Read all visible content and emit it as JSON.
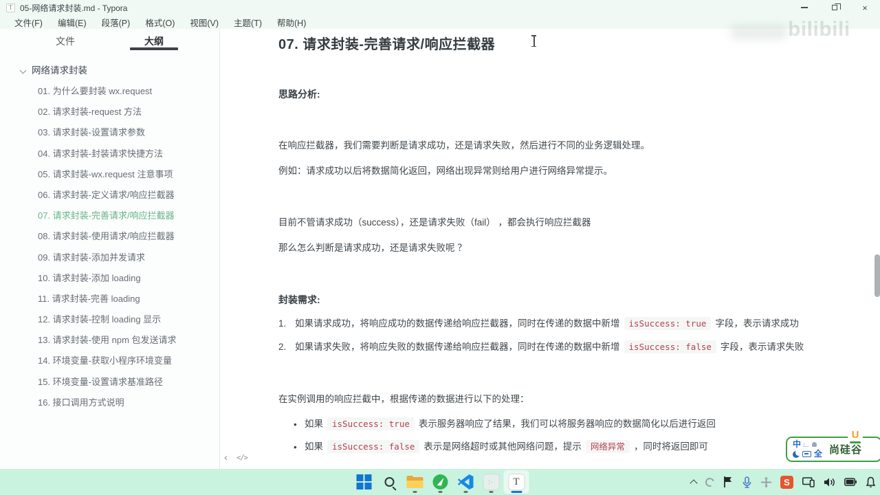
{
  "window": {
    "app_icon": "T",
    "title": "05-网络请求封装.md - Typora",
    "menu": [
      "文件(F)",
      "编辑(E)",
      "段落(P)",
      "格式(O)",
      "视图(V)",
      "主题(T)",
      "帮助(H)"
    ],
    "controls": {
      "close": "×"
    }
  },
  "sidebar": {
    "tabs": {
      "files": "文件",
      "outline": "大纲"
    },
    "root": "网络请求封装",
    "items": [
      "01. 为什么要封装 wx.request",
      "02. 请求封装-request 方法",
      "03. 请求封装-设置请求参数",
      "04. 请求封装-封装请求快捷方法",
      "05. 请求封装-wx.request 注意事项",
      "06. 请求封装-定义请求/响应拦截器",
      "07. 请求封装-完善请求/响应拦截器",
      "08. 请求封装-使用请求/响应拦截器",
      "09. 请求封装-添加并发请求",
      "10. 请求封装-添加 loading",
      "11. 请求封装-完善 loading",
      "12. 请求封装-控制 loading 显示",
      "13. 请求封装-使用 npm 包发送请求",
      "14. 环境变量-获取小程序环境变量",
      "15. 环境变量-设置请求基准路径",
      "16. 接口调用方式说明"
    ],
    "active_item": "07. 请求封装-完善请求/响应拦截器"
  },
  "editor_footer": {
    "collapse": "‹",
    "source_mode": "</>"
  },
  "content": {
    "heading": "07. 请求封装-完善请求/响应拦截器",
    "analysis_label": "思路分析:",
    "p1": "在响应拦截器，我们需要判断是请求成功，还是请求失败，然后进行不同的业务逻辑处理。",
    "p2": "例如：请求成功以后将数据简化返回，网络出现异常则给用户进行网络异常提示。",
    "p3": "目前不管请求成功（success），还是请求失败（fail） ，都会执行响应拦截器",
    "p4": "那么怎么判断是请求成功，还是请求失败呢 ？",
    "require_label": "封装需求:",
    "ol": [
      {
        "num": "1.",
        "pre": "如果请求成功，将响应成功的数据传递给响应拦截器，同时在传递的数据中新增",
        "code": "isSuccess: true",
        "post": "字段，表示请求成功"
      },
      {
        "num": "2.",
        "pre": "如果请求失败，将响应失败的数据传递给响应拦截器，同时在传递的数据中新增",
        "code": "isSuccess: false",
        "post": "字段，表示请求失败"
      }
    ],
    "p5": "在实例调用的响应拦截中，根据传递的数据进行以下的处理：",
    "ul": [
      {
        "pre": "如果",
        "code": "isSuccess: true",
        "post": "表示服务器响应了结果，我们可以将服务器响应的数据简化以后进行返回"
      },
      {
        "pre": "如果",
        "code": "isSuccess: false",
        "mid": "表示是网络超时或其他网络问题，提示",
        "code2": "网络异常",
        "post": "，同时将返回即可"
      }
    ]
  },
  "watermark": "bilibili",
  "badge": {
    "ime_cn": "中",
    "ime_full": "全",
    "brand": "尚硅谷",
    "logo": "U"
  },
  "taskbar": {
    "icons": [
      "start",
      "search",
      "file-explorer",
      "wechat-devtools",
      "vscode",
      "background-app",
      "typora"
    ],
    "tray": [
      "hidden-icons",
      "sync",
      "flag",
      "microphone",
      "move",
      "sogou-input",
      "cast",
      "volume",
      "battery",
      "bell"
    ]
  },
  "colors": {
    "accent_green": "#65b587",
    "code_red": "#b3424e",
    "code_bg": "#f5f6f6",
    "taskbar_bg": "#c9f2df",
    "badge_border": "#3f9e45",
    "tab_underline": "#3e4347"
  }
}
